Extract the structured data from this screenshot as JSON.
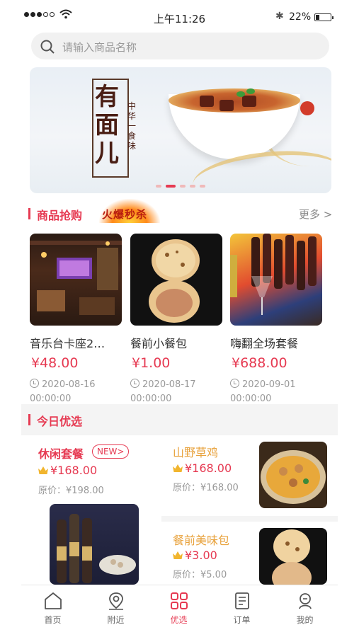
{
  "status_bar": {
    "time": "上午11:26",
    "battery": "22%"
  },
  "search": {
    "placeholder": "请输入商品名称"
  },
  "banner": {
    "title": "有面儿",
    "subtitle": "中华一食味"
  },
  "flash_sale": {
    "title": "商品抢购",
    "badge": "火爆秒杀",
    "more": "更多 >",
    "items": [
      {
        "name": "音乐台卡座2…",
        "price": "¥48.00",
        "date": "2020-08-16",
        "time": "00:00:00"
      },
      {
        "name": "餐前小餐包",
        "price": "¥1.00",
        "date": "2020-08-17",
        "time": "00:00:00"
      },
      {
        "name": "嗨翻全场套餐",
        "price": "¥688.00",
        "date": "2020-09-01",
        "time": "00:00:00"
      }
    ]
  },
  "today": {
    "title": "今日优选",
    "featured": {
      "name": "休闲套餐",
      "badge": "NEW>",
      "price": "¥168.00",
      "original": "原价：¥198.00"
    },
    "items": [
      {
        "name": "山野草鸡",
        "price": "¥168.00",
        "original": "原价：¥168.00"
      },
      {
        "name": "餐前美味包",
        "price": "¥3.00",
        "original": "原价：¥5.00"
      }
    ]
  },
  "tabbar": {
    "items": [
      {
        "label": "首页",
        "icon": "home-icon"
      },
      {
        "label": "附近",
        "icon": "location-icon"
      },
      {
        "label": "优选",
        "icon": "grid-icon",
        "active": true
      },
      {
        "label": "订单",
        "icon": "order-icon"
      },
      {
        "label": "我的",
        "icon": "profile-icon"
      }
    ]
  },
  "colors": {
    "accent": "#e63a52",
    "gold_text": "#e8a23c",
    "muted": "#999999"
  }
}
